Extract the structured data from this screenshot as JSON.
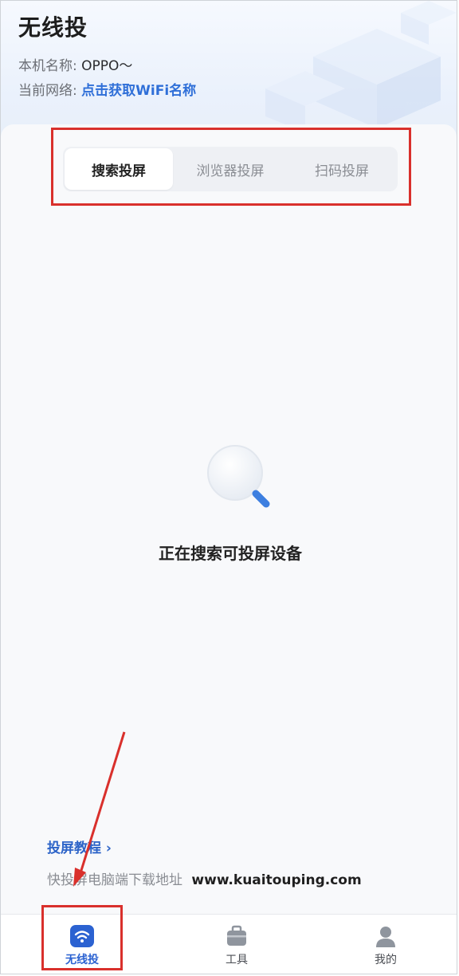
{
  "app": {
    "title": "无线投"
  },
  "device": {
    "label": "本机名称:",
    "value": "OPPO～"
  },
  "network": {
    "label": "当前网络:",
    "link": "点击获取WiFi名称"
  },
  "tabs": [
    {
      "label": "搜索投屏",
      "active": true
    },
    {
      "label": "浏览器投屏",
      "active": false
    },
    {
      "label": "扫码投屏",
      "active": false
    }
  ],
  "status": {
    "text": "正在搜索可投屏设备"
  },
  "footer": {
    "tutorial": "投屏教程 ›",
    "download_label": "快投屏电脑端下载地址",
    "download_url": "www.kuaitouping.com"
  },
  "bottom_nav": [
    {
      "label": "无线投",
      "icon": "wifi-cast-icon",
      "active": true
    },
    {
      "label": "工具",
      "icon": "toolbox-icon",
      "active": false
    },
    {
      "label": "我的",
      "icon": "user-icon",
      "active": false
    }
  ],
  "colors": {
    "accent": "#2f6fd8",
    "annotation": "#d9302c"
  }
}
